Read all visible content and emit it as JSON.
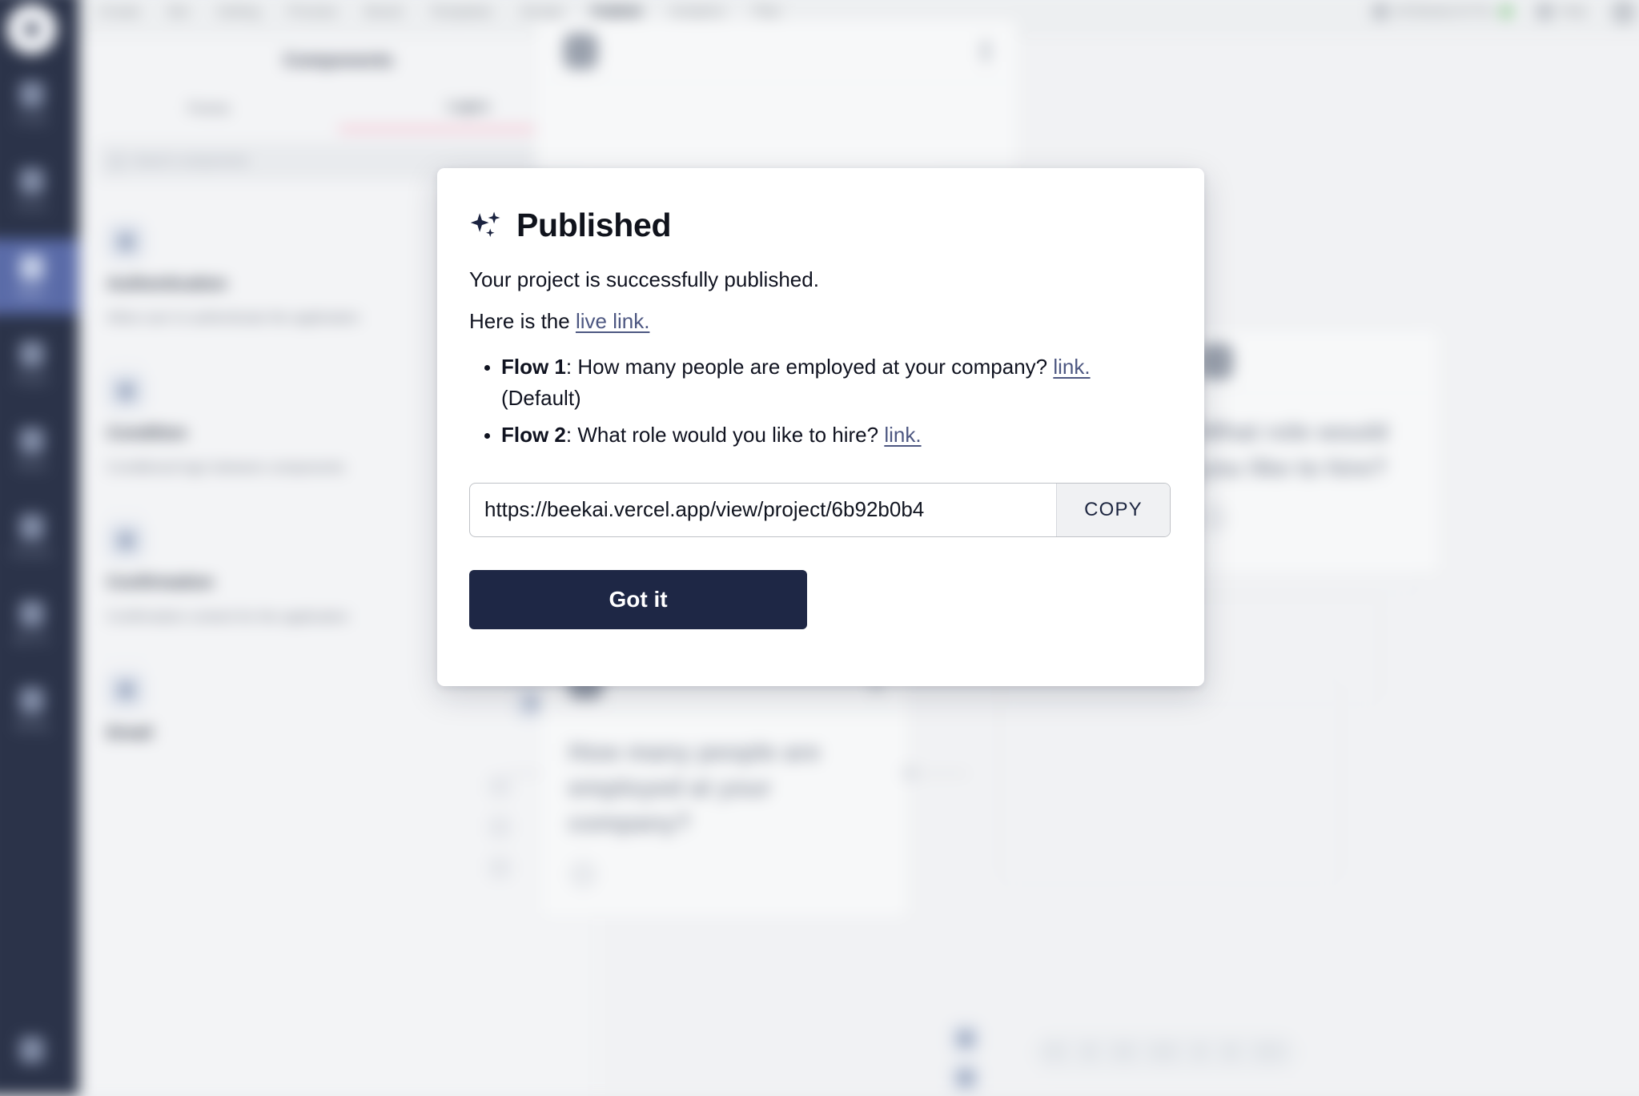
{
  "app": {
    "rail": {
      "logo_icon": "app-logo-icon",
      "items": [
        {
          "label": "Create",
          "icon": "create-icon",
          "active": false
        },
        {
          "label": "Forms",
          "icon": "forms-icon",
          "active": false
        },
        {
          "label": "Editor",
          "icon": "editor-icon",
          "active": true
        },
        {
          "label": "Project",
          "icon": "project-icon",
          "active": false
        },
        {
          "label": "Teams",
          "icon": "teams-icon",
          "active": false
        },
        {
          "label": "Connect",
          "icon": "connect-icon",
          "active": false
        },
        {
          "label": "My Pro",
          "icon": "my-pro-icon",
          "active": false
        },
        {
          "label": "Setting",
          "icon": "setting-icon",
          "active": false
        }
      ],
      "bottom_icon": "help-bottom-icon"
    },
    "topbar": {
      "tabs": [
        {
          "label": "Create",
          "selected": false
        },
        {
          "label": "Bot",
          "selected": false
        },
        {
          "label": "Setting",
          "selected": false
        },
        {
          "label": "Preview",
          "selected": false
        },
        {
          "label": "Brand",
          "selected": false
        },
        {
          "label": "Templates",
          "selected": false
        },
        {
          "label": "Design",
          "selected": false
        },
        {
          "label": "Publish",
          "selected": true
        },
        {
          "label": "Analytics",
          "selected": false
        },
        {
          "label": "Plan",
          "selected": false
        }
      ],
      "upgrade_label": "All Beekai AI Pro",
      "upgrade_icon": "rocket-icon",
      "upgrade_status_icon": "status-dot-icon",
      "help_label": "Help",
      "help_icon": "help-icon",
      "avatar_icon": "user-avatar-icon"
    },
    "panel": {
      "title": "Components",
      "close_icon": "close-icon",
      "tabs": [
        {
          "label": "Forms",
          "selected": false
        },
        {
          "label": "Logics",
          "selected": true
        }
      ],
      "search_placeholder": "Search components",
      "search_icon": "search-icon",
      "components": [
        {
          "name": "Authentication",
          "description": "Allow user to authenticate the application",
          "icon": "authentication-icon",
          "badge": false
        },
        {
          "name": "Condition",
          "description": "Conditional logic between components",
          "icon": "condition-icon",
          "badge": false
        },
        {
          "name": "Confirmation",
          "description": "Confirmation content for the application",
          "icon": "confirmation-icon",
          "badge": true
        },
        {
          "name": "Email",
          "description": "",
          "icon": "email-icon",
          "badge": true
        }
      ]
    },
    "canvas": {
      "nodes": [
        {
          "question": "",
          "avatar_icon": "node-avatar-icon",
          "menu_icon": "node-menu-icon"
        },
        {
          "question": "How many people are employed at your company?",
          "avatar_icon": "node-avatar-icon",
          "menu_icon": "node-menu-icon"
        },
        {
          "question": "What role would you like to hire?",
          "avatar_icon": "node-avatar-icon",
          "menu_icon": "node-menu-icon"
        }
      ]
    }
  },
  "modal": {
    "title": "Published",
    "title_icon": "sparkles-icon",
    "paragraph_1": "Your project is successfully published.",
    "paragraph_2_prefix": "Here is the ",
    "live_link_label": "live link.",
    "flows": [
      {
        "name": "Flow 1",
        "separator": ": ",
        "question": "How many people are employed at your company? ",
        "link_label": "link.",
        "suffix": " (Default)"
      },
      {
        "name": "Flow 2",
        "separator": ": ",
        "question": "What role would you like to hire? ",
        "link_label": "link.",
        "suffix": ""
      }
    ],
    "url_value": "https://beekai.vercel.app/view/project/6b92b0b4",
    "url_placeholder": "https://",
    "copy_label": "COPY",
    "got_it_label": "Got it",
    "colors": {
      "primary_button": "#1e2745",
      "link": "#4d5781",
      "title": "#10131c",
      "copy_button_bg": "#f0f1f3"
    }
  }
}
